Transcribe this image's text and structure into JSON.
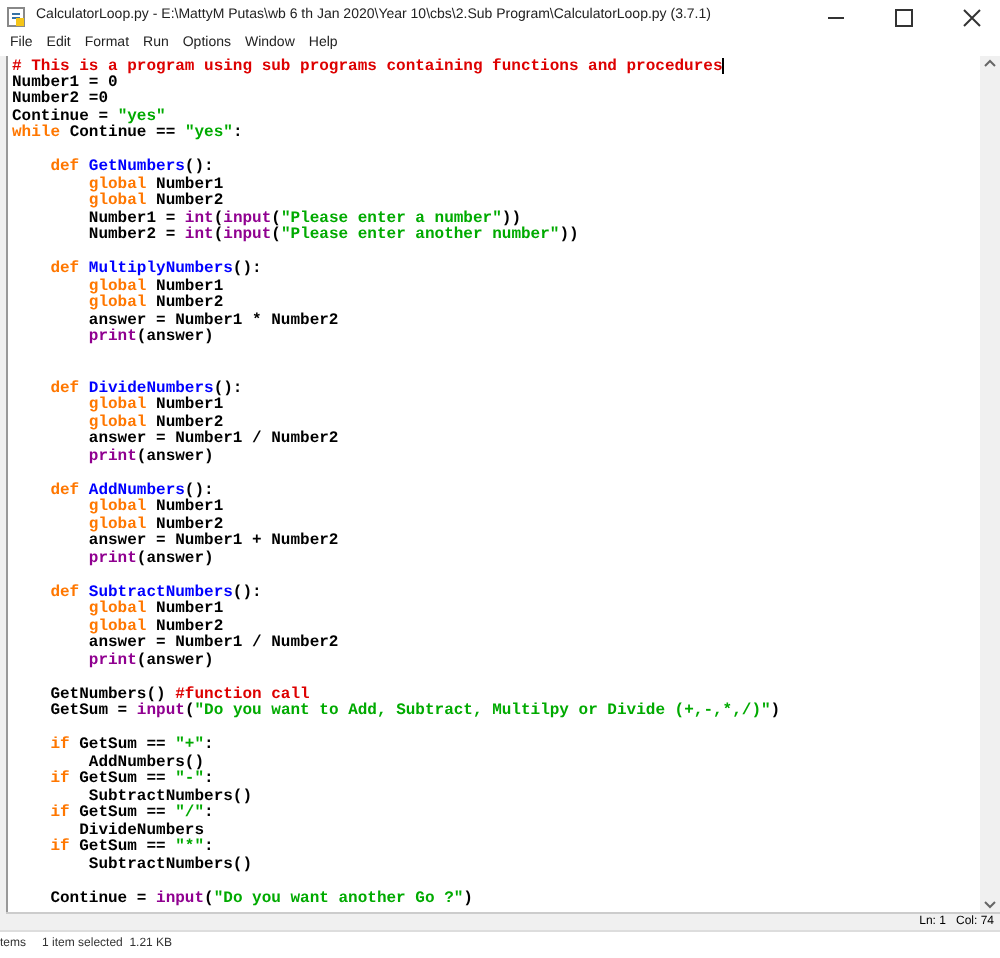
{
  "window": {
    "title": "CalculatorLoop.py - E:\\MattyM Putas\\wb 6 th Jan 2020\\Year 10\\cbs\\2.Sub Program\\CalculatorLoop.py (3.7.1)"
  },
  "menu": [
    "File",
    "Edit",
    "Format",
    "Run",
    "Options",
    "Window",
    "Help"
  ],
  "code": [
    {
      "kind": "code",
      "tokens": [
        {
          "text": "# This is a program using sub programs containing functions and procedures",
          "kind": "comment"
        }
      ]
    },
    {
      "kind": "code",
      "tokens": [
        {
          "text": "Number1 = 0",
          "kind": "plain"
        }
      ]
    },
    {
      "kind": "code",
      "tokens": [
        {
          "text": "Number2 =0",
          "kind": "plain"
        }
      ]
    },
    {
      "kind": "code",
      "tokens": [
        {
          "text": "Continue = ",
          "kind": "plain"
        },
        {
          "text": "\"yes\"",
          "kind": "string"
        }
      ]
    },
    {
      "kind": "code",
      "tokens": [
        {
          "text": "while",
          "kind": "keyword"
        },
        {
          "text": " Continue == ",
          "kind": "plain"
        },
        {
          "text": "\"yes\"",
          "kind": "string"
        },
        {
          "text": ":",
          "kind": "plain"
        }
      ]
    },
    {
      "kind": "blank"
    },
    {
      "kind": "code",
      "tokens": [
        {
          "text": "    def ",
          "kind": "keyword"
        },
        {
          "text": "GetNumbers",
          "kind": "defname"
        },
        {
          "text": "():",
          "kind": "plain"
        }
      ]
    },
    {
      "kind": "code",
      "tokens": [
        {
          "text": "        global",
          "kind": "keyword"
        },
        {
          "text": " Number1",
          "kind": "plain"
        }
      ]
    },
    {
      "kind": "code",
      "tokens": [
        {
          "text": "        global",
          "kind": "keyword"
        },
        {
          "text": " Number2",
          "kind": "plain"
        }
      ]
    },
    {
      "kind": "code",
      "tokens": [
        {
          "text": "        Number1 = ",
          "kind": "plain"
        },
        {
          "text": "int",
          "kind": "builtin"
        },
        {
          "text": "(",
          "kind": "plain"
        },
        {
          "text": "input",
          "kind": "builtin"
        },
        {
          "text": "(",
          "kind": "plain"
        },
        {
          "text": "\"Please enter a number\"",
          "kind": "string"
        },
        {
          "text": "))",
          "kind": "plain"
        }
      ]
    },
    {
      "kind": "code",
      "tokens": [
        {
          "text": "        Number2 = ",
          "kind": "plain"
        },
        {
          "text": "int",
          "kind": "builtin"
        },
        {
          "text": "(",
          "kind": "plain"
        },
        {
          "text": "input",
          "kind": "builtin"
        },
        {
          "text": "(",
          "kind": "plain"
        },
        {
          "text": "\"Please enter another number\"",
          "kind": "string"
        },
        {
          "text": "))",
          "kind": "plain"
        }
      ]
    },
    {
      "kind": "blank"
    },
    {
      "kind": "code",
      "tokens": [
        {
          "text": "    def ",
          "kind": "keyword"
        },
        {
          "text": "MultiplyNumbers",
          "kind": "defname"
        },
        {
          "text": "():",
          "kind": "plain"
        }
      ]
    },
    {
      "kind": "code",
      "tokens": [
        {
          "text": "        global",
          "kind": "keyword"
        },
        {
          "text": " Number1",
          "kind": "plain"
        }
      ]
    },
    {
      "kind": "code",
      "tokens": [
        {
          "text": "        global",
          "kind": "keyword"
        },
        {
          "text": " Number2",
          "kind": "plain"
        }
      ]
    },
    {
      "kind": "code",
      "tokens": [
        {
          "text": "        answer = Number1 * Number2",
          "kind": "plain"
        }
      ]
    },
    {
      "kind": "code",
      "tokens": [
        {
          "text": "        print",
          "kind": "builtin"
        },
        {
          "text": "(answer)",
          "kind": "plain"
        }
      ]
    },
    {
      "kind": "blank"
    },
    {
      "kind": "blank"
    },
    {
      "kind": "code",
      "tokens": [
        {
          "text": "    def ",
          "kind": "keyword"
        },
        {
          "text": "DivideNumbers",
          "kind": "defname"
        },
        {
          "text": "():",
          "kind": "plain"
        }
      ]
    },
    {
      "kind": "code",
      "tokens": [
        {
          "text": "        global",
          "kind": "keyword"
        },
        {
          "text": " Number1",
          "kind": "plain"
        }
      ]
    },
    {
      "kind": "code",
      "tokens": [
        {
          "text": "        global",
          "kind": "keyword"
        },
        {
          "text": " Number2",
          "kind": "plain"
        }
      ]
    },
    {
      "kind": "code",
      "tokens": [
        {
          "text": "        answer = Number1 / Number2",
          "kind": "plain"
        }
      ]
    },
    {
      "kind": "code",
      "tokens": [
        {
          "text": "        print",
          "kind": "builtin"
        },
        {
          "text": "(answer)",
          "kind": "plain"
        }
      ]
    },
    {
      "kind": "blank"
    },
    {
      "kind": "code",
      "tokens": [
        {
          "text": "    def ",
          "kind": "keyword"
        },
        {
          "text": "AddNumbers",
          "kind": "defname"
        },
        {
          "text": "():",
          "kind": "plain"
        }
      ]
    },
    {
      "kind": "code",
      "tokens": [
        {
          "text": "        global",
          "kind": "keyword"
        },
        {
          "text": " Number1",
          "kind": "plain"
        }
      ]
    },
    {
      "kind": "code",
      "tokens": [
        {
          "text": "        global",
          "kind": "keyword"
        },
        {
          "text": " Number2",
          "kind": "plain"
        }
      ]
    },
    {
      "kind": "code",
      "tokens": [
        {
          "text": "        answer = Number1 + Number2",
          "kind": "plain"
        }
      ]
    },
    {
      "kind": "code",
      "tokens": [
        {
          "text": "        print",
          "kind": "builtin"
        },
        {
          "text": "(answer)",
          "kind": "plain"
        }
      ]
    },
    {
      "kind": "blank"
    },
    {
      "kind": "code",
      "tokens": [
        {
          "text": "    def ",
          "kind": "keyword"
        },
        {
          "text": "SubtractNumbers",
          "kind": "defname"
        },
        {
          "text": "():",
          "kind": "plain"
        }
      ]
    },
    {
      "kind": "code",
      "tokens": [
        {
          "text": "        global",
          "kind": "keyword"
        },
        {
          "text": " Number1",
          "kind": "plain"
        }
      ]
    },
    {
      "kind": "code",
      "tokens": [
        {
          "text": "        global",
          "kind": "keyword"
        },
        {
          "text": " Number2",
          "kind": "plain"
        }
      ]
    },
    {
      "kind": "code",
      "tokens": [
        {
          "text": "        answer = Number1 / Number2",
          "kind": "plain"
        }
      ]
    },
    {
      "kind": "code",
      "tokens": [
        {
          "text": "        print",
          "kind": "builtin"
        },
        {
          "text": "(answer)",
          "kind": "plain"
        }
      ]
    },
    {
      "kind": "blank"
    },
    {
      "kind": "code",
      "tokens": [
        {
          "text": "    GetNumbers() ",
          "kind": "plain"
        },
        {
          "text": "#function call",
          "kind": "comment"
        }
      ]
    },
    {
      "kind": "code",
      "tokens": [
        {
          "text": "    GetSum = ",
          "kind": "plain"
        },
        {
          "text": "input",
          "kind": "builtin"
        },
        {
          "text": "(",
          "kind": "plain"
        },
        {
          "text": "\"Do you want to Add, Subtract, Multilpy or Divide (+,-,*,/)\"",
          "kind": "string"
        },
        {
          "text": ")",
          "kind": "plain"
        }
      ]
    },
    {
      "kind": "blank"
    },
    {
      "kind": "code",
      "tokens": [
        {
          "text": "    if",
          "kind": "keyword"
        },
        {
          "text": " GetSum == ",
          "kind": "plain"
        },
        {
          "text": "\"+\"",
          "kind": "string"
        },
        {
          "text": ":",
          "kind": "plain"
        }
      ]
    },
    {
      "kind": "code",
      "tokens": [
        {
          "text": "        AddNumbers()",
          "kind": "plain"
        }
      ]
    },
    {
      "kind": "code",
      "tokens": [
        {
          "text": "    if",
          "kind": "keyword"
        },
        {
          "text": " GetSum == ",
          "kind": "plain"
        },
        {
          "text": "\"-\"",
          "kind": "string"
        },
        {
          "text": ":",
          "kind": "plain"
        }
      ]
    },
    {
      "kind": "code",
      "tokens": [
        {
          "text": "        SubtractNumbers()",
          "kind": "plain"
        }
      ]
    },
    {
      "kind": "code",
      "tokens": [
        {
          "text": "    if",
          "kind": "keyword"
        },
        {
          "text": " GetSum == ",
          "kind": "plain"
        },
        {
          "text": "\"/\"",
          "kind": "string"
        },
        {
          "text": ":",
          "kind": "plain"
        }
      ]
    },
    {
      "kind": "code",
      "tokens": [
        {
          "text": "       DivideNumbers",
          "kind": "plain"
        }
      ]
    },
    {
      "kind": "code",
      "tokens": [
        {
          "text": "    if",
          "kind": "keyword"
        },
        {
          "text": " GetSum == ",
          "kind": "plain"
        },
        {
          "text": "\"*\"",
          "kind": "string"
        },
        {
          "text": ":",
          "kind": "plain"
        }
      ]
    },
    {
      "kind": "code",
      "tokens": [
        {
          "text": "        SubtractNumbers()",
          "kind": "plain"
        }
      ]
    },
    {
      "kind": "blank"
    },
    {
      "kind": "code",
      "tokens": [
        {
          "text": "    Continue = ",
          "kind": "plain"
        },
        {
          "text": "input",
          "kind": "builtin"
        },
        {
          "text": "(",
          "kind": "plain"
        },
        {
          "text": "\"Do you want another Go ?\"",
          "kind": "string"
        },
        {
          "text": ")",
          "kind": "plain"
        }
      ]
    }
  ],
  "status_bar": {
    "line": "Ln: 1",
    "column": "Col: 74"
  },
  "explorer_status": {
    "items": "tems",
    "selection": "1 item selected  1.21 KB"
  }
}
